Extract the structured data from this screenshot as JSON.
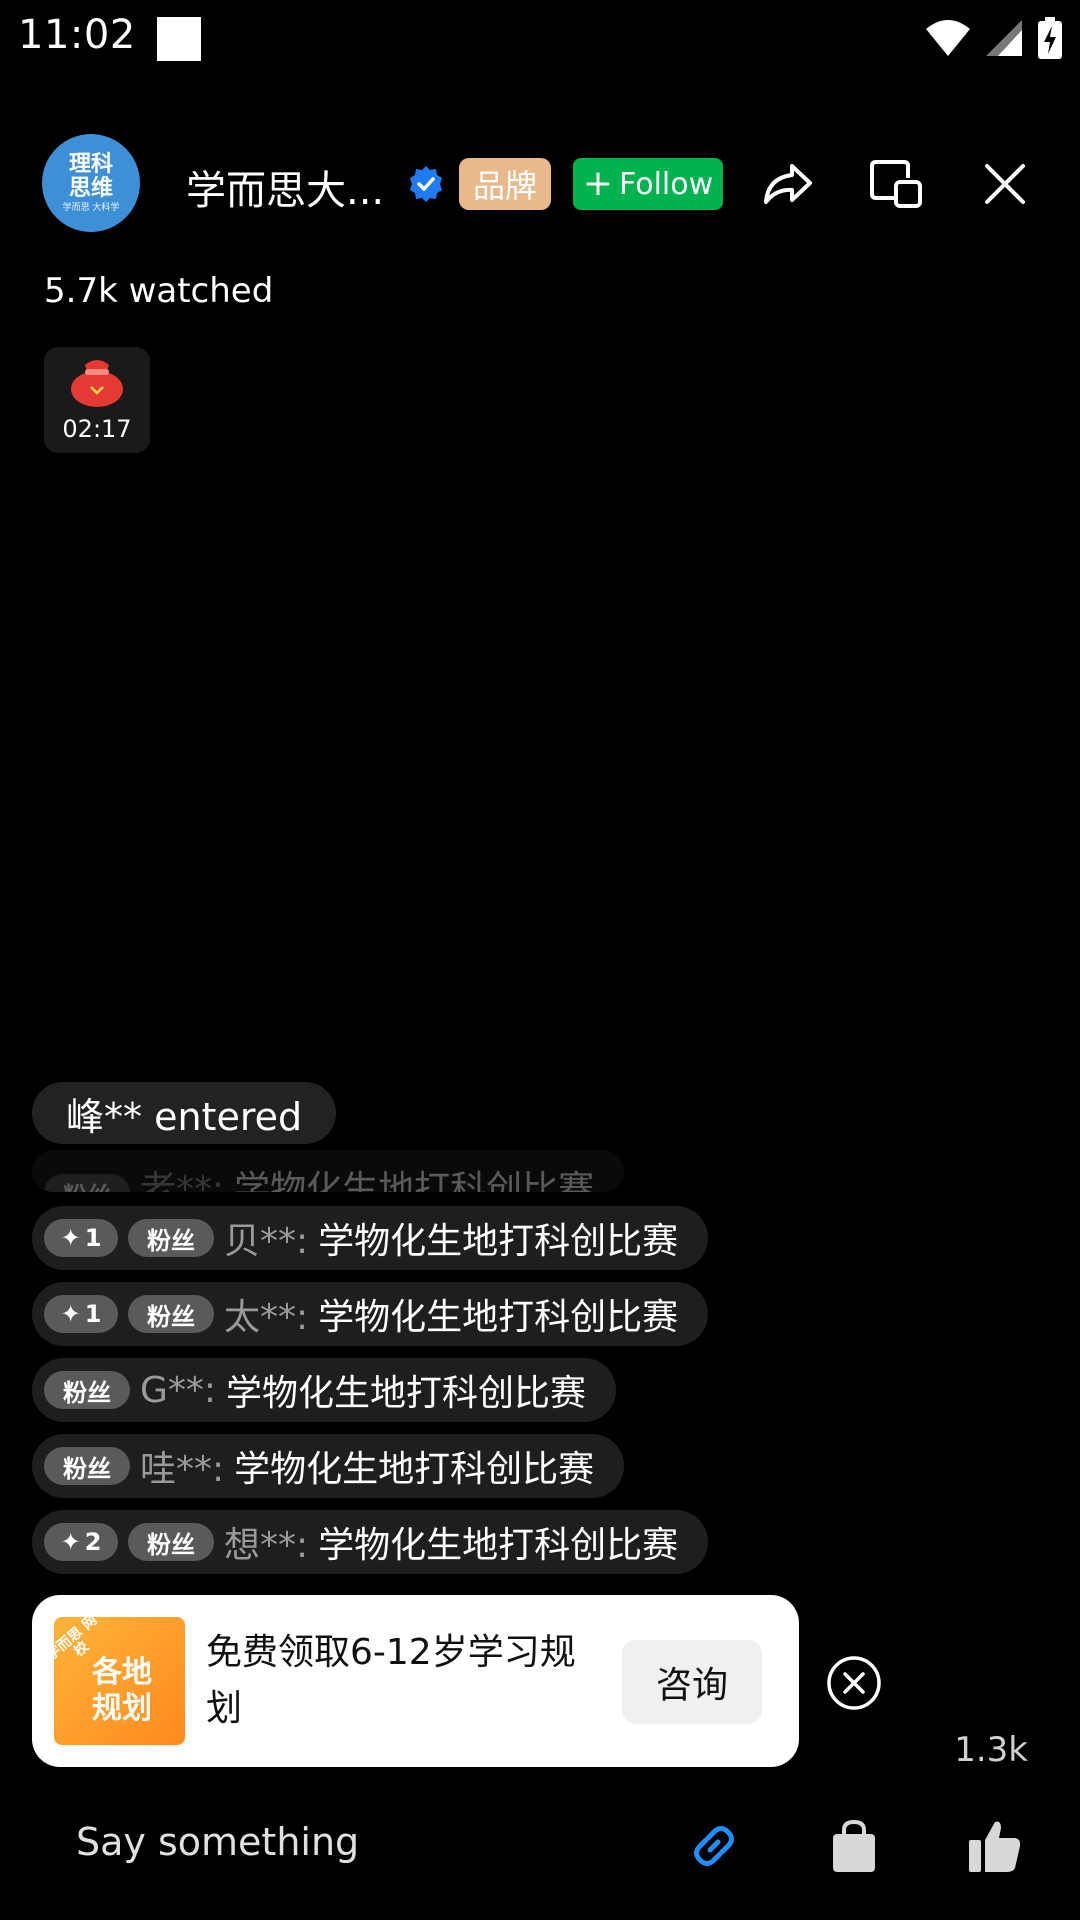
{
  "status_bar": {
    "time": "11:02",
    "icons": [
      "wifi-icon",
      "cell-signal-icon",
      "battery-charging-icon"
    ]
  },
  "header": {
    "avatar_text": [
      "理科",
      "思维"
    ],
    "avatar_sub": "学而思 大科学",
    "host_name": "学而思大...",
    "brand_tag": "品牌",
    "follow_label": "Follow",
    "icons": [
      "share-icon",
      "screen-switch-icon",
      "close-icon"
    ]
  },
  "watched": "5.7k watched",
  "red_packet": {
    "icon": "red-packet-icon",
    "countdown": "02:17"
  },
  "chat": {
    "entered": "峰** entered",
    "faded": {
      "badge": "粉丝",
      "user": "老**:",
      "text": "学物化生地打科创比赛"
    },
    "messages": [
      {
        "level": "1",
        "badge": "粉丝",
        "user": "贝**:",
        "text": "学物化生地打科创比赛"
      },
      {
        "level": "1",
        "badge": "粉丝",
        "user": "太**:",
        "text": "学物化生地打科创比赛"
      },
      {
        "level": "",
        "badge": "粉丝",
        "user": "G**:",
        "text": "学物化生地打科创比赛"
      },
      {
        "level": "",
        "badge": "粉丝",
        "user": "哇**:",
        "text": "学物化生地打科创比赛"
      },
      {
        "level": "2",
        "badge": "粉丝",
        "user": "想**:",
        "text": "学物化生地打科创比赛"
      }
    ]
  },
  "promo": {
    "thumb_tag": "学而思 网校",
    "thumb_main": "各地 规划",
    "title": "免费领取6-12岁学习规划",
    "button": "咨询"
  },
  "like_count": "1.3k",
  "bottom_bar": {
    "placeholder": "Say something",
    "icons": [
      "link-icon",
      "shopping-bag-icon",
      "thumbs-up-icon"
    ],
    "link_color": "#1e8fff"
  }
}
